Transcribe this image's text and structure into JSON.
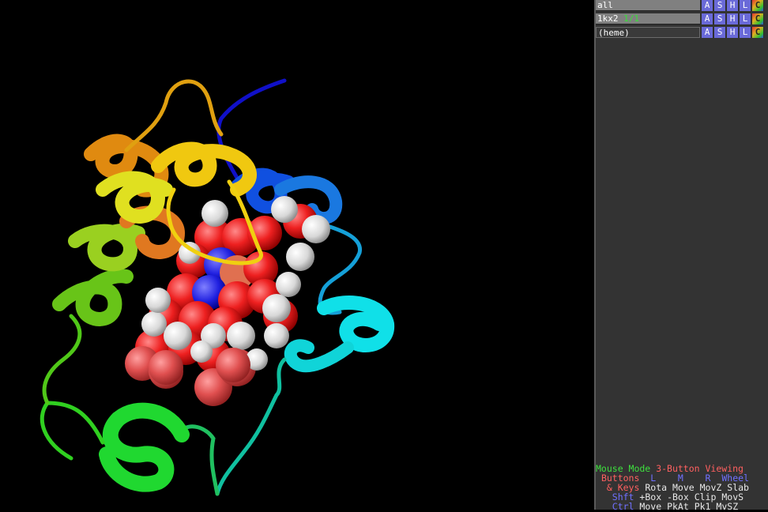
{
  "objects": [
    {
      "name": "all",
      "state": "",
      "buttons": [
        "A",
        "S",
        "H",
        "L",
        "C"
      ]
    },
    {
      "name": "1kx2",
      "state": "1/1",
      "buttons": [
        "A",
        "S",
        "H",
        "L",
        "C"
      ]
    },
    {
      "name": "(heme)",
      "state": "",
      "buttons": [
        "A",
        "S",
        "H",
        "L",
        "C"
      ]
    }
  ],
  "mouse_info": {
    "mode_label": "Mouse Mode",
    "mode_value": "3-Button Viewing",
    "buttons_label": "Buttons",
    "col_L": "L",
    "col_M": "M",
    "col_R": "R",
    "col_wheel": "Wheel",
    "keys_label": "& Keys",
    "keys_row": [
      "Rota",
      "Move",
      "MovZ",
      "Slab"
    ],
    "shft_label": "Shft",
    "shft_row": [
      "+Box",
      "-Box",
      "Clip",
      "MovS"
    ],
    "ctrl_label": "Ctrl",
    "ctrl_row": [
      "Move",
      "PkAt",
      "Pk1",
      "MvSZ"
    ]
  }
}
